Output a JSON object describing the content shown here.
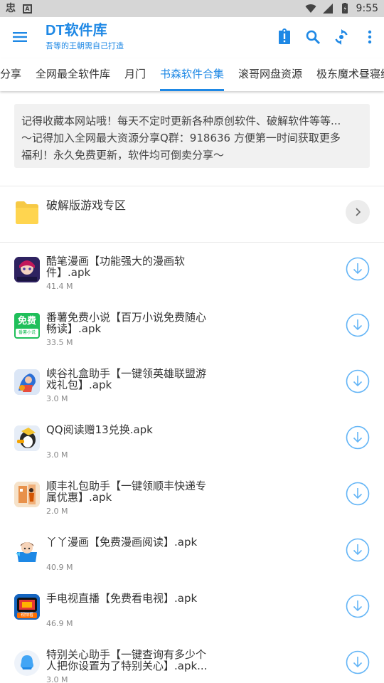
{
  "status_bar": {
    "left_glyphs": [
      "忠",
      "A"
    ],
    "icons": [
      "wifi-icon",
      "signal-icon",
      "battery-icon"
    ],
    "time": "9:55"
  },
  "app_bar": {
    "title": "DT软件库",
    "subtitle": "吾等的王朝需自己打造",
    "actions": [
      "notice-icon",
      "search-icon",
      "refresh-icon",
      "more-icon"
    ]
  },
  "tabs": [
    {
      "label": "分享"
    },
    {
      "label": "全网最全软件库"
    },
    {
      "label": "月门"
    },
    {
      "label": "书森软件合集"
    },
    {
      "label": "滚哥网盘资源"
    },
    {
      "label": "极东魔术昼寝结"
    }
  ],
  "active_tab_label": "书森软件合集",
  "notice": {
    "line1": "记得收藏本网站哦！每天不定时更新各种原创软件、破解软件等等...",
    "line2": "～记得加入全网最大资源分享Q群：918636 方便第一时间获取更多",
    "line3": "福利！永久免费更新，软件均可倒卖分享～"
  },
  "folder": {
    "name": "破解版游戏专区",
    "icon": "folder-icon"
  },
  "files": [
    {
      "name_line1": "酷笔漫画【功能强大的漫画软",
      "name_line2": "件】.apk",
      "size": "41.4 M",
      "icon": "comic-app-icon"
    },
    {
      "name_line1": "番薯免费小说【百万小说免费随心",
      "name_line2": "畅读】.apk",
      "size": "33.5 M",
      "icon": "novel-app-icon",
      "icon_text": "免费",
      "icon_sub": "番薯小说"
    },
    {
      "name_line1": "峡谷礼盒助手【一键领英雄联盟游",
      "name_line2": "戏礼包】.apk",
      "size": "3.0 M",
      "icon": "game-gift-app-icon"
    },
    {
      "name_line1": "QQ阅读赠13兑换.apk",
      "name_line2": "",
      "size": "3.0 M",
      "icon": "qq-reader-app-icon"
    },
    {
      "name_line1": "顺丰礼包助手【一键领顺丰快递专",
      "name_line2": "属优惠】.apk",
      "size": "2.0 M",
      "icon": "sf-gift-app-icon"
    },
    {
      "name_line1": "丫丫漫画【免费漫画阅读】.apk",
      "name_line2": "",
      "size": "40.9 M",
      "icon": "yaya-comic-app-icon"
    },
    {
      "name_line1": "手电视直播【免费看电视】.apk",
      "name_line2": "",
      "size": "46.9 M",
      "icon": "tv-live-app-icon",
      "icon_text": "视频看"
    },
    {
      "name_line1": "特别关心助手【一键查询有多少个",
      "name_line2": "人把你设置为了特别关心】.apk...",
      "size": "3.0 M",
      "icon": "qq-care-app-icon"
    }
  ],
  "colors": {
    "accent": "#1e88e5",
    "status_bar": "#d6d6d6",
    "notice_bg": "#f1f1f1",
    "download_ring": "#64b5f6",
    "folder": "#ffd54f"
  }
}
